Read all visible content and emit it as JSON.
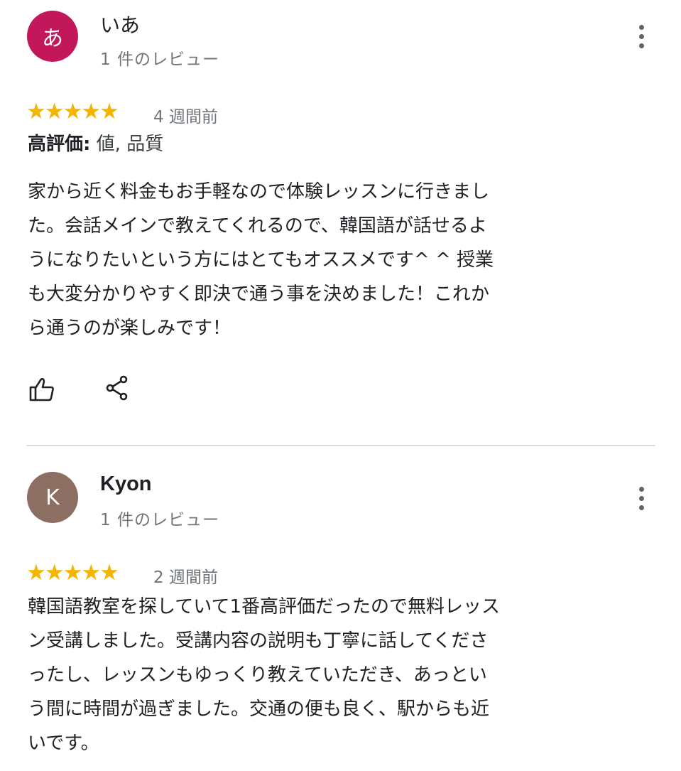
{
  "reviews": [
    {
      "avatar_letter": "あ",
      "avatar_color": "#c2185b",
      "name": "いあ",
      "review_count": "1 件のレビュー",
      "rating": 5,
      "stars": "★★★★★",
      "time": "4 週間前",
      "highlights_label": "高評価:",
      "highlights_value": " 値, 品質",
      "text": "家から近く料金もお手軽なので体験レッスンに行きまし\nた。会話メインで教えてくれるので、韓国語が話せるよ\nうになりたいという方にはとてもオススメです^ ^ 授業\nも大変分かりやすく即決で通う事を決めました！これか\nら通うのが楽しみです！",
      "icons": {
        "like": "thumbs-up-icon",
        "share": "share-icon",
        "more": "more-vert-icon"
      }
    },
    {
      "avatar_letter": "K",
      "avatar_color": "#8d6e63",
      "name": "Kyon",
      "review_count": "1 件のレビュー",
      "rating": 5,
      "stars": "★★★★★",
      "time": "2 週間前",
      "text": "韓国語教室を探していて1番高評価だったので無料レッス\nン受講しました。受講内容の説明も丁寧に話してくださ\nったし、レッスンもゆっくり教えていただき、あっとい\nう間に時間が過ぎました。交通の便も良く、駅からも近\nいです。",
      "icons": {
        "more": "more-vert-icon"
      }
    }
  ],
  "colors": {
    "star": "#f4b400",
    "secondary_text": "#70757a",
    "divider": "#dadce0"
  }
}
